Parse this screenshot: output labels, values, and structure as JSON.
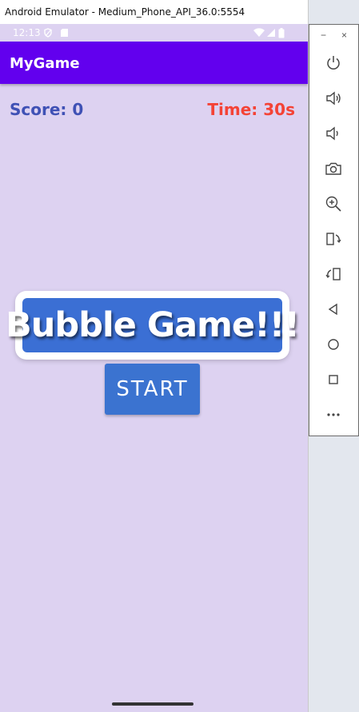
{
  "window": {
    "title": "Android Emulator - Medium_Phone_API_36.0:5554"
  },
  "statusbar": {
    "time": "12:13"
  },
  "app": {
    "title": "MyGame",
    "score": "Score: 0",
    "time": "Time: 30s",
    "game_title": "Bubble Game!!!",
    "start_label": "START"
  },
  "colors": {
    "app_bar": "#6200ee",
    "background": "#ddd2f1",
    "score": "#3f51b5",
    "time": "#f44336",
    "button": "#3b73d0"
  },
  "toolbar": {
    "minimize": "−",
    "close": "×",
    "items": [
      "power-icon",
      "volume-up-icon",
      "volume-down-icon",
      "camera-icon",
      "zoom-icon",
      "rotate-left-icon",
      "rotate-right-icon",
      "back-icon",
      "home-icon",
      "overview-icon",
      "more-icon"
    ]
  }
}
